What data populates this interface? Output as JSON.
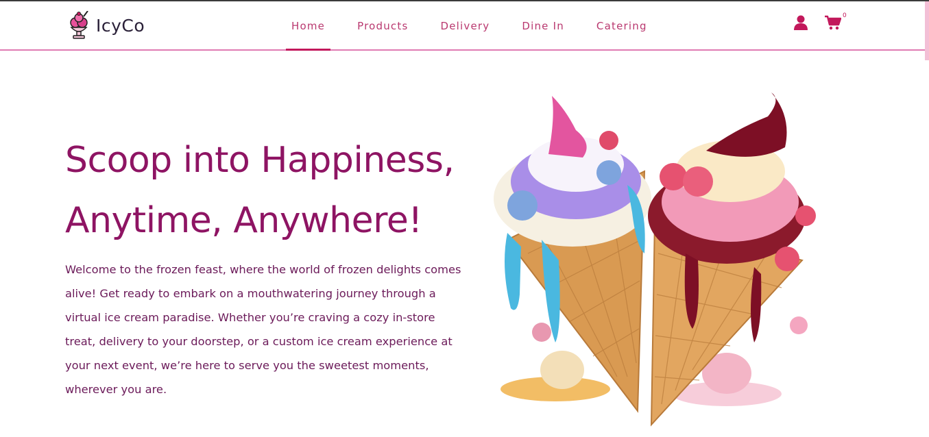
{
  "brand": {
    "name": "IcyCo",
    "logo_icon": "ice-cream-sundae-icon"
  },
  "nav": {
    "items": [
      {
        "label": "Home",
        "active": true
      },
      {
        "label": "Products",
        "active": false
      },
      {
        "label": "Delivery",
        "active": false
      },
      {
        "label": "Dine In",
        "active": false
      },
      {
        "label": "Catering",
        "active": false
      }
    ]
  },
  "header_icons": {
    "user_icon": "user-icon",
    "cart_icon": "cart-icon",
    "cart_count": "0"
  },
  "hero": {
    "title_line1": "Scoop into Happiness,",
    "title_line2": "Anytime, Anywhere!",
    "description": "Welcome to the frozen feast, where the world of frozen delights comes alive! Get ready to embark on a mouthwatering journey through a virtual ice cream paradise. Whether you’re craving a cozy in-store treat, delivery to your doorstep, or a custom ice cream experience at your next event, we’re here to serve you the sweetest moments, wherever you are.",
    "image": "two-ice-cream-cones-image"
  },
  "colors": {
    "accent": "#c2185b",
    "title": "#8e1463",
    "text": "#6b1a59",
    "header_border": "#e07ab2"
  }
}
